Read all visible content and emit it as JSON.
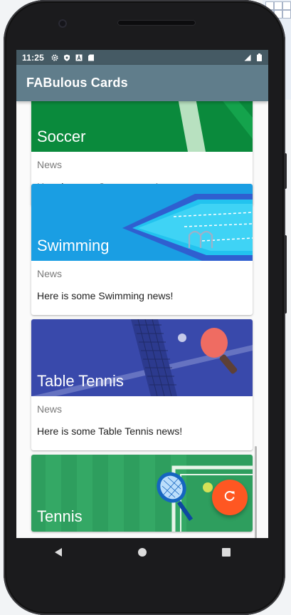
{
  "status_bar": {
    "time": "11:25",
    "left_icons": [
      "settings-icon",
      "shield-icon",
      "a-icon",
      "sd-card-icon"
    ],
    "right_icons": [
      "signal-icon",
      "battery-icon"
    ]
  },
  "app_bar": {
    "title": "FABulous Cards"
  },
  "cards": [
    {
      "title": "Soccer",
      "subtitle": "News",
      "text": "Here is some Soccer news!",
      "image": "soccer-image"
    },
    {
      "title": "Swimming",
      "subtitle": "News",
      "text": "Here is some Swimming news!",
      "image": "swimming-image"
    },
    {
      "title": "Table Tennis",
      "subtitle": "News",
      "text": "Here is some Table Tennis news!",
      "image": "table-tennis-image"
    },
    {
      "title": "Tennis",
      "subtitle": "",
      "text": "",
      "image": "tennis-image"
    }
  ],
  "fab": {
    "icon": "refresh-icon",
    "color": "#ff5722"
  },
  "nav_bar": {
    "buttons": [
      "back-icon",
      "home-icon",
      "recents-icon"
    ]
  },
  "colors": {
    "status_bar": "#455a64",
    "app_bar": "#607d8b",
    "accent": "#ff5722"
  }
}
